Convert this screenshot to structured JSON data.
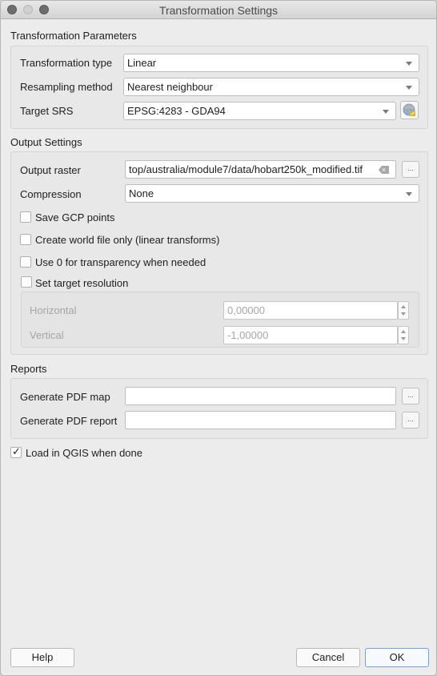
{
  "window": {
    "title": "Transformation Settings"
  },
  "transformation_parameters": {
    "title": "Transformation Parameters",
    "transformation_type": {
      "label": "Transformation type",
      "value": "Linear"
    },
    "resampling_method": {
      "label": "Resampling method",
      "value": "Nearest neighbour"
    },
    "target_srs": {
      "label": "Target SRS",
      "value": "EPSG:4283 - GDA94"
    }
  },
  "output_settings": {
    "title": "Output Settings",
    "output_raster": {
      "label": "Output raster",
      "value": "top/australia/module7/data/hobart250k_modified.tif",
      "browse": "..."
    },
    "compression": {
      "label": "Compression",
      "value": "None"
    },
    "checkboxes": [
      {
        "label": "Save GCP points",
        "checked": false
      },
      {
        "label": "Create world file only (linear transforms)",
        "checked": false
      },
      {
        "label": "Use 0 for transparency when needed",
        "checked": false
      },
      {
        "label": "Set target resolution",
        "checked": false
      }
    ],
    "resolution": {
      "horizontal": {
        "label": "Horizontal",
        "value": "0,00000"
      },
      "vertical": {
        "label": "Vertical",
        "value": "-1,00000"
      }
    }
  },
  "reports": {
    "title": "Reports",
    "pdf_map": {
      "label": "Generate PDF map",
      "value": "",
      "browse": "..."
    },
    "pdf_report": {
      "label": "Generate PDF report",
      "value": "",
      "browse": "..."
    }
  },
  "load_in_qgis": {
    "label": "Load in QGIS when done",
    "checked": true
  },
  "buttons": {
    "help": "Help",
    "cancel": "Cancel",
    "ok": "OK"
  }
}
